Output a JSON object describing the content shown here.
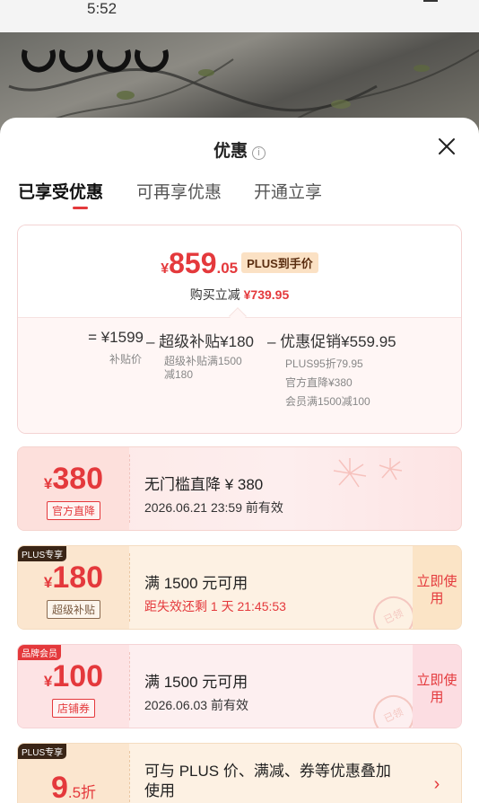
{
  "status_bar": {
    "time": "5:52"
  },
  "header": {
    "title": "优惠",
    "info_symbol": "i"
  },
  "tabs": [
    {
      "label": "已享受优惠",
      "active": true
    },
    {
      "label": "可再享优惠",
      "active": false
    },
    {
      "label": "开通立享",
      "active": false
    }
  ],
  "summary": {
    "currency": "¥",
    "price_int": "859",
    "price_dec": ".05",
    "price_tag": "PLUS到手价",
    "reduce_label": "购买立减",
    "reduce_amount": "¥739.95",
    "formula": {
      "base_main": "= ¥1599",
      "base_sub": "补贴价",
      "subsidy_main": "– 超级补贴¥180",
      "subsidy_sub": [
        "超级补贴满1500",
        "减180"
      ],
      "promo_main": "– 优惠促销¥559.95",
      "promo_sub": [
        "PLUS95折79.95",
        "官方直降¥380",
        "会员满1500减100"
      ]
    }
  },
  "coupons": [
    {
      "badge": "",
      "currency": "¥",
      "amount": "380",
      "type": "官方直降",
      "title": "无门槛直降 ¥ 380",
      "subtitle": "2026.06.21 23:59 前有效",
      "action": ""
    },
    {
      "badge": "PLUS专享",
      "currency": "¥",
      "amount": "180",
      "type": "超级补贴",
      "title": "满 1500 元可用",
      "subtitle": "距失效还剩 1 天 21:45:53",
      "action": "立即使用",
      "stamp": "已领"
    },
    {
      "badge": "品牌会员",
      "currency": "¥",
      "amount": "100",
      "type": "店铺券",
      "title": "满 1500 元可用",
      "subtitle": "2026.06.03 前有效",
      "action": "立即使用",
      "stamp": "已领"
    },
    {
      "badge": "PLUS专享",
      "amount": "9",
      "amount_dec": ".5",
      "unit": "折",
      "title": "可与 PLUS 价、满减、券等优惠叠加",
      "title2": "使用",
      "action": "›"
    }
  ],
  "colors": {
    "accent": "#e4393c",
    "plus_gold": "#fbe1c4",
    "brand_pink": "#fdeceb"
  }
}
